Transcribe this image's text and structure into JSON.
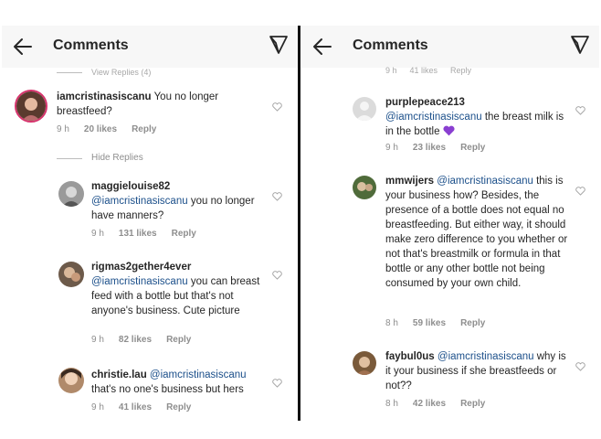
{
  "left": {
    "header": {
      "title": "Comments"
    },
    "top_cutoff": {
      "text": "View Replies (4)"
    },
    "hide_replies": {
      "label": "Hide Replies"
    },
    "comments": [
      {
        "username": "iamcristinasiscanu",
        "mention": "",
        "body": "You no longer breastfeed?",
        "time": "9 h",
        "likes": "20 likes",
        "reply": "Reply"
      },
      {
        "username": "maggielouise82",
        "mention": "@iamcristinasiscanu",
        "body": "you no longer have manners?",
        "time": "9 h",
        "likes": "131 likes",
        "reply": "Reply"
      },
      {
        "username": "rigmas2gether4ever",
        "mention": "@iamcristinasiscanu",
        "body": "you can breast feed with a bottle but that's not anyone's business. Cute picture",
        "time": "9 h",
        "likes": "82 likes",
        "reply": "Reply"
      },
      {
        "username": "christie.lau",
        "mention": "@iamcristinasiscanu",
        "body": "that's no one's business but hers",
        "time": "9 h",
        "likes": "41 likes",
        "reply": "Reply"
      }
    ]
  },
  "right": {
    "header": {
      "title": "Comments"
    },
    "top_cutoff": {
      "time": "9 h",
      "likes": "41 likes",
      "reply": "Reply"
    },
    "comments": [
      {
        "username": "purplepeace213",
        "mention": "@iamcristinasiscanu",
        "body": "the breast milk is in the bottle",
        "emoji": "purple-heart",
        "time": "9 h",
        "likes": "23 likes",
        "reply": "Reply"
      },
      {
        "username": "mmwijers",
        "mention": "@iamcristinasiscanu",
        "body": "this is your business how? Besides, the presence of a bottle does not equal no breastfeeding. But either way, it should make zero difference to you whether or not that's breastmilk or formula in that bottle or any other bottle not being consumed by your own child.",
        "time": "8 h",
        "likes": "59 likes",
        "reply": "Reply"
      },
      {
        "username": "faybul0us",
        "mention": "@iamcristinasiscanu",
        "body": "why is it your business if she breastfeeds or not??",
        "time": "8 h",
        "likes": "42 likes",
        "reply": "Reply"
      }
    ]
  },
  "colors": {
    "mention": "#1b4f8a",
    "meta": "#8e8e8e",
    "emoji_heart": "#8a3fd1"
  }
}
